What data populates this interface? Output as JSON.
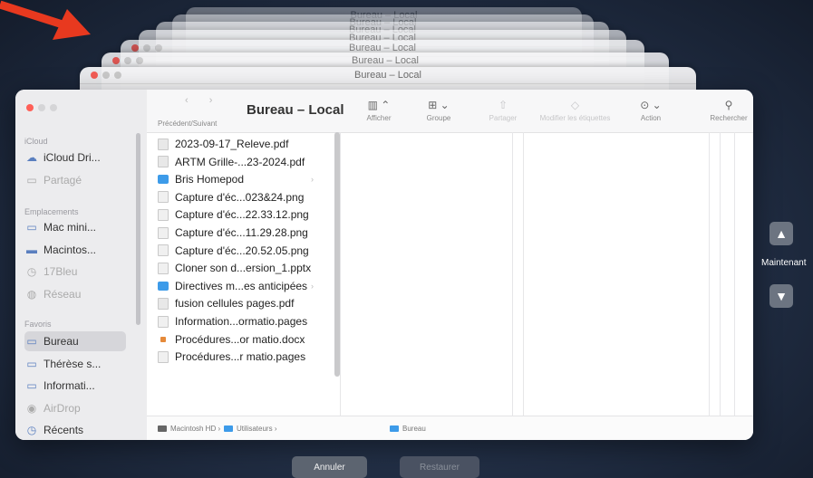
{
  "window": {
    "title": "Bureau – Local",
    "nav_label": "Précédent/Suivant",
    "nav_arrows": "‹ ›"
  },
  "background_windows": {
    "title": "Bureau – Local"
  },
  "toolbar": {
    "afficher": "Afficher",
    "groupe": "Groupe",
    "partager": "Partager",
    "etiquettes": "Modifier les étiquettes",
    "action": "Action",
    "rechercher": "Rechercher"
  },
  "sidebar": {
    "icloud_heading": "iCloud",
    "icloud_items": [
      {
        "label": "iCloud Dri...",
        "icon": "cloud-icon"
      },
      {
        "label": "Partagé",
        "icon": "shared-folder-icon"
      }
    ],
    "locations_heading": "Emplacements",
    "locations_items": [
      {
        "label": "Mac mini...",
        "icon": "display-icon"
      },
      {
        "label": "Macintos...",
        "icon": "hard-drive-icon"
      },
      {
        "label": "17Bleu",
        "icon": "clock-icon"
      },
      {
        "label": "Réseau",
        "icon": "network-icon"
      }
    ],
    "favorites_heading": "Favoris",
    "favorites_items": [
      {
        "label": "Bureau",
        "icon": "desktop-folder-icon"
      },
      {
        "label": "Thérèse s...",
        "icon": "folder-icon"
      },
      {
        "label": "Informati...",
        "icon": "folder-icon"
      },
      {
        "label": "AirDrop",
        "icon": "airdrop-icon"
      },
      {
        "label": "Récents",
        "icon": "clock-icon"
      }
    ]
  },
  "files": [
    {
      "name": "2023-09-17_Releve.pdf",
      "type": "pdf"
    },
    {
      "name": "ARTM Grille-...23-2024.pdf",
      "type": "pdf"
    },
    {
      "name": "Bris Homepod",
      "type": "folder"
    },
    {
      "name": "Capture d'éc...023&24.png",
      "type": "img"
    },
    {
      "name": "Capture d'éc...22.33.12.png",
      "type": "img"
    },
    {
      "name": "Capture d'éc...11.29.28.png",
      "type": "img"
    },
    {
      "name": "Capture d'éc...20.52.05.png",
      "type": "img"
    },
    {
      "name": "Cloner son d...ersion_1.pptx",
      "type": "img"
    },
    {
      "name": "Directives m...es anticipées",
      "type": "folder"
    },
    {
      "name": "fusion cellules pages.pdf",
      "type": "pdf"
    },
    {
      "name": "Information...ormatio.pages",
      "type": "img"
    },
    {
      "name": "Procédures...or matio.docx",
      "type": "docx"
    },
    {
      "name": "Procédures...r matio.pages",
      "type": "img"
    }
  ],
  "pathbar": {
    "disk": "Macintosh HD",
    "users": "Utilisateurs",
    "current": "Bureau",
    "separator": "›"
  },
  "buttons": {
    "cancel": "Annuler",
    "restore": "Restaurer"
  },
  "timeline": {
    "label": "Maintenant",
    "up": "▲",
    "down": "▼"
  },
  "colors": {
    "accent": "#3d9be9",
    "arrow": "#e8391f",
    "close": "#ff5f57",
    "minimize": "#c9c9c9"
  }
}
